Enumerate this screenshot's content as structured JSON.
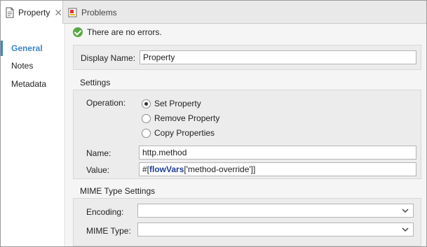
{
  "tabs": [
    {
      "label": "Property",
      "active": true
    },
    {
      "label": "Problems",
      "active": false
    }
  ],
  "sidebar": {
    "items": [
      {
        "label": "General",
        "active": true
      },
      {
        "label": "Notes",
        "active": false
      },
      {
        "label": "Metadata",
        "active": false
      }
    ]
  },
  "status": {
    "text": "There are no errors."
  },
  "display": {
    "label": "Display Name:",
    "value": "Property"
  },
  "settings": {
    "title": "Settings",
    "operation_label": "Operation:",
    "options": [
      {
        "label": "Set Property",
        "checked": true
      },
      {
        "label": "Remove Property",
        "checked": false
      },
      {
        "label": "Copy Properties",
        "checked": false
      }
    ],
    "name_label": "Name:",
    "name_value": "http.method",
    "value_label": "Value:",
    "value_expr": {
      "prefix": "#[",
      "keyword": "flowVars",
      "suffix": "['method-override']]"
    }
  },
  "mime": {
    "title": "MIME Type Settings",
    "encoding_label": "Encoding:",
    "encoding_value": "",
    "mime_type_label": "MIME Type:",
    "mime_type_value": ""
  },
  "colors": {
    "accent": "#3a86c8",
    "ok": "#5aa845",
    "keyword": "#1f3f93"
  }
}
